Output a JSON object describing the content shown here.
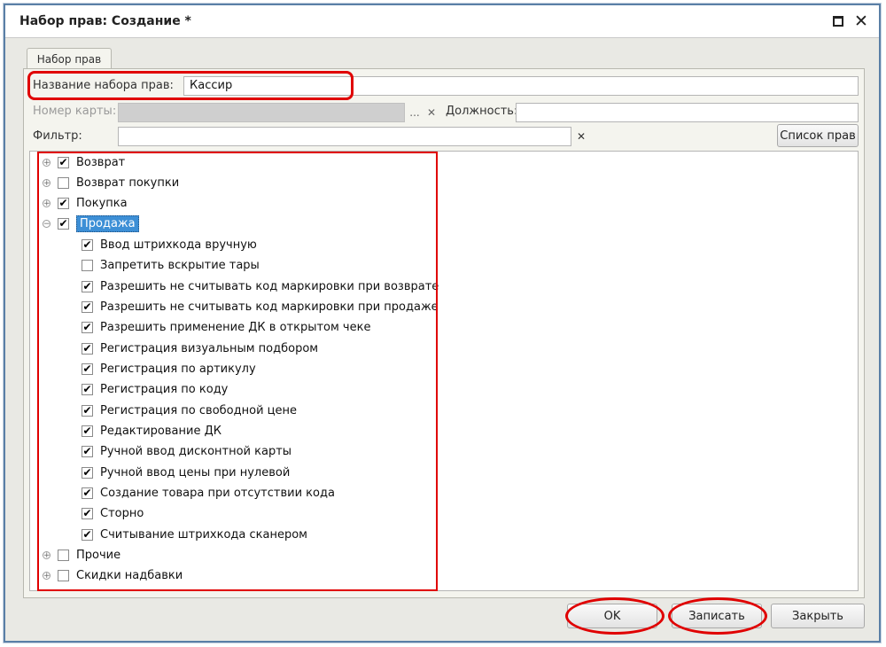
{
  "window": {
    "title": "Набор прав: Создание *"
  },
  "tab": {
    "label": "Набор прав"
  },
  "form": {
    "name_label": "Название набора прав:",
    "name_value": "Кассир",
    "card_label": "Номер карты:",
    "card_value": "",
    "card_select": "...",
    "position_label": "Должность:",
    "position_value": "",
    "filter_label": "Фильтр:",
    "filter_value": "",
    "rights_list_button": "Список прав"
  },
  "tree": {
    "items": [
      {
        "label": "Возврат",
        "checked": true,
        "expanded": false
      },
      {
        "label": "Возврат покупки",
        "checked": false,
        "expanded": false
      },
      {
        "label": "Покупка",
        "checked": true,
        "expanded": false
      },
      {
        "label": "Продажа",
        "checked": true,
        "expanded": true,
        "selected": true
      },
      {
        "label": "Прочие",
        "checked": false,
        "expanded": false
      },
      {
        "label": "Скидки надбавки",
        "checked": false,
        "expanded": false
      }
    ],
    "children": [
      {
        "label": "Ввод штрихкода вручную",
        "checked": true
      },
      {
        "label": "Запретить вскрытие тары",
        "checked": false
      },
      {
        "label": "Разрешить не считывать код маркировки при возврате",
        "checked": true
      },
      {
        "label": "Разрешить не считывать код маркировки при продаже",
        "checked": true
      },
      {
        "label": "Разрешить применение ДК в открытом чеке",
        "checked": true
      },
      {
        "label": "Регистрация визуальным подбором",
        "checked": true
      },
      {
        "label": "Регистрация по артикулу",
        "checked": true
      },
      {
        "label": "Регистрация по коду",
        "checked": true
      },
      {
        "label": "Регистрация по свободной цене",
        "checked": true
      },
      {
        "label": "Редактирование ДК",
        "checked": true
      },
      {
        "label": "Ручной ввод дисконтной карты",
        "checked": true
      },
      {
        "label": "Ручной ввод цены при нулевой",
        "checked": true
      },
      {
        "label": "Создание товара при отсутствии кода",
        "checked": true
      },
      {
        "label": "Сторно",
        "checked": true
      },
      {
        "label": "Считывание штрихкода сканером",
        "checked": true
      }
    ]
  },
  "footer": {
    "ok": "OK",
    "save": "Записать",
    "close": "Закрыть"
  },
  "icons": {
    "check": "✔",
    "clear": "✕",
    "plus": "+",
    "minus": "−"
  },
  "colors": {
    "highlight_red": "#e00000",
    "selection_blue": "#3d8fd6"
  }
}
